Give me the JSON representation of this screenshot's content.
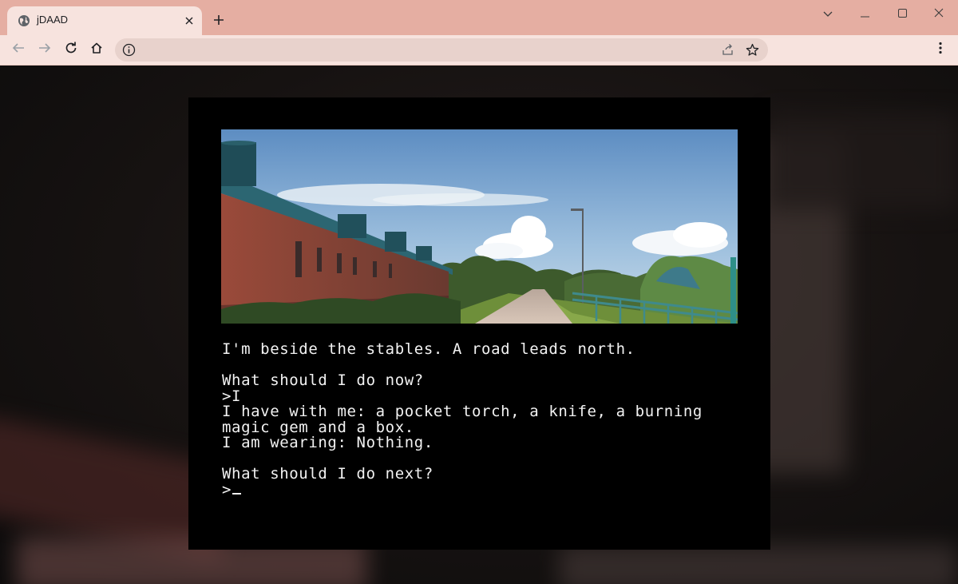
{
  "browser": {
    "tab_title": "jDAAD",
    "address": "",
    "icons": {
      "favicon": "globe-icon",
      "close": "close-icon",
      "new_tab": "plus-icon",
      "back": "arrow-left-icon",
      "forward": "arrow-right-icon",
      "reload": "reload-icon",
      "home": "home-icon",
      "site_info": "info-icon",
      "share": "share-icon",
      "bookmark": "star-icon",
      "menu": "kebab-menu-icon",
      "tab_search": "chevron-down-icon",
      "minimize": "minimize-icon",
      "maximize": "maximize-icon",
      "window_close": "close-icon"
    },
    "colors": {
      "titlebar": "#e5aea2",
      "toolbar": "#f7e3de",
      "omnibox": "#e8d2cc"
    }
  },
  "game": {
    "scene_image": "stables-road-scene",
    "lines": [
      "I'm beside the stables. A road leads north.",
      "",
      "What should I do now?",
      ">I",
      "I have with me: a pocket torch, a knife, a burning",
      "magic gem and a box.",
      "I am wearing: Nothing.",
      "",
      "What should I do next?"
    ],
    "prompt": ">",
    "colors": {
      "screen": "#000000",
      "text": "#f2f2f2"
    }
  }
}
